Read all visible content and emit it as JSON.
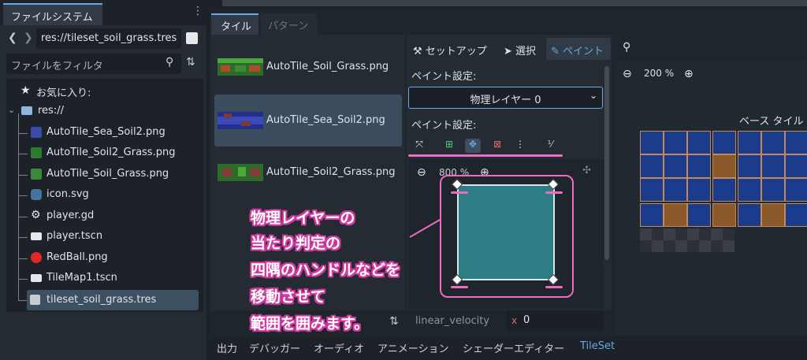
{
  "filesystem": {
    "tab_label": "ファイルシステム",
    "menu_glyph": "⋮",
    "path": "res://tileset_soil_grass.tres",
    "filter_placeholder": "ファイルをフィルタ",
    "tree": [
      {
        "label": "お気に入り:",
        "icon": "star-icon"
      },
      {
        "label": "res://",
        "icon": "folder-icon"
      },
      {
        "label": "AutoTile_Sea_Soil2.png",
        "icon": "image-icon"
      },
      {
        "label": "AutoTile_Soil2_Grass.png",
        "icon": "image-icon"
      },
      {
        "label": "AutoTile_Soil_Grass.png",
        "icon": "image-icon"
      },
      {
        "label": "icon.svg",
        "icon": "godot-icon"
      },
      {
        "label": "player.gd",
        "icon": "gear-icon"
      },
      {
        "label": "player.tscn",
        "icon": "scene-icon"
      },
      {
        "label": "RedBall.png",
        "icon": "red-ball-icon"
      },
      {
        "label": "TileMap1.tscn",
        "icon": "scene-icon"
      },
      {
        "label": "tileset_soil_grass.tres",
        "icon": "tileset-icon",
        "selected": true
      }
    ]
  },
  "tileset_editor": {
    "tabs": [
      {
        "label": "タイル",
        "active": true
      },
      {
        "label": "パターン",
        "active": false
      }
    ],
    "atlas_sources": [
      {
        "label": "AutoTile_Soil_Grass.png",
        "selected": false
      },
      {
        "label": "AutoTile_Sea_Soil2.png",
        "selected": true
      },
      {
        "label": "AutoTile_Soil2_Grass.png",
        "selected": false
      }
    ],
    "toolbar": {
      "setup": "セットアップ",
      "select": "選択",
      "paint": "ペイント"
    },
    "paint_settings_label_1": "ペイント設定:",
    "physics_layer_select": "物理レイヤー 0",
    "paint_settings_label_2": "ペイント設定:",
    "polygon_zoom": "800 %",
    "atlas_zoom": "200 %",
    "base_tiles_label": "ベース タイル",
    "property": {
      "name": "linear_velocity",
      "axis": "x",
      "value": "0"
    }
  },
  "annotation": {
    "lines": [
      "物理レイヤーの",
      "当たり判定の",
      "四隅のハンドルなどを",
      "移動させて",
      "範囲を囲みます。"
    ]
  },
  "bottom_panel": {
    "tabs": [
      "出力",
      "デバッガー",
      "オーディオ",
      "アニメーション",
      "シェーダーエディター",
      "TileSet"
    ],
    "active": "TileSet"
  },
  "colors": {
    "accent": "#6aa7e8",
    "annotation_pink": "#ef6bc1",
    "polygon_fill": "#2d7d85"
  }
}
